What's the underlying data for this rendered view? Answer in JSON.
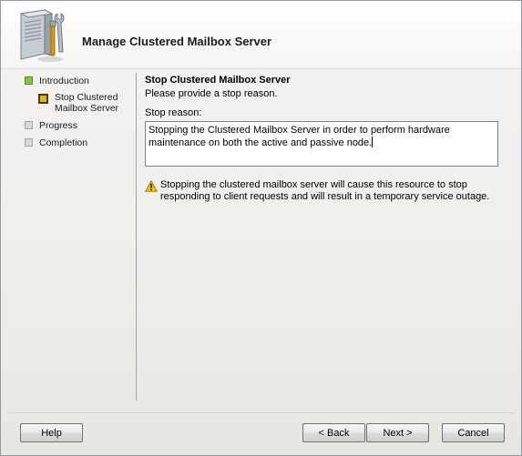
{
  "header": {
    "title": "Manage Clustered Mailbox Server",
    "icon": "server-tools-icon"
  },
  "nav": {
    "items": [
      {
        "label": "Introduction",
        "state": "completed"
      },
      {
        "label": "Stop Clustered Mailbox Server",
        "state": "current"
      },
      {
        "label": "Progress",
        "state": "pending"
      },
      {
        "label": "Completion",
        "state": "pending"
      }
    ]
  },
  "content": {
    "title": "Stop Clustered Mailbox Server",
    "subtitle": "Please provide a stop reason.",
    "field_label": "Stop reason:",
    "reason_value": "Stopping the Clustered Mailbox Server in order to perform hardware maintenance on both the active and passive node.",
    "warning_text": "Stopping the clustered mailbox server will cause this resource to stop responding to client requests and will result in a temporary service outage."
  },
  "buttons": {
    "help": "Help",
    "back": "< Back",
    "next": "Next >",
    "cancel": "Cancel"
  },
  "colors": {
    "completed": "#8bc34a",
    "current": "#e3b325",
    "pending": "#d8d8d8",
    "warning": "#f2c200"
  }
}
